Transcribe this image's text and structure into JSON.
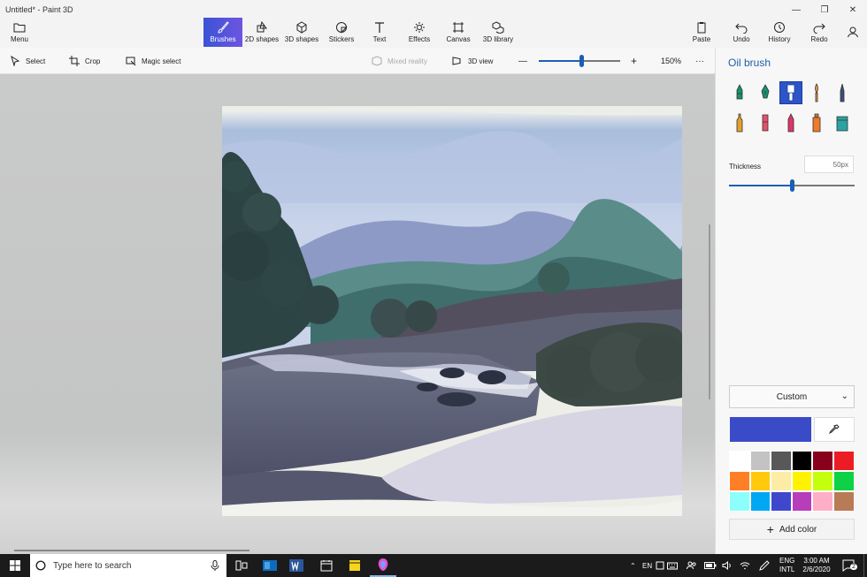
{
  "window": {
    "title": "Untitled* - Paint 3D",
    "controls": [
      "—",
      "❐",
      "✕"
    ]
  },
  "ribbon": {
    "menu_label": "Menu",
    "tabs": [
      {
        "label": "Brushes",
        "icon": "brush-icon",
        "active": true
      },
      {
        "label": "2D shapes",
        "icon": "2d-shapes-icon"
      },
      {
        "label": "3D shapes",
        "icon": "3d-shapes-icon"
      },
      {
        "label": "Stickers",
        "icon": "stickers-icon"
      },
      {
        "label": "Text",
        "icon": "text-icon"
      },
      {
        "label": "Effects",
        "icon": "effects-icon"
      },
      {
        "label": "Canvas",
        "icon": "canvas-icon"
      },
      {
        "label": "3D library",
        "icon": "3d-library-icon"
      }
    ],
    "actions": [
      {
        "label": "Paste",
        "icon": "paste-icon"
      },
      {
        "label": "Undo",
        "icon": "undo-icon"
      },
      {
        "label": "History",
        "icon": "history-icon"
      },
      {
        "label": "Redo",
        "icon": "redo-icon"
      }
    ],
    "user_icon": "user-icon"
  },
  "toolbar": {
    "select_label": "Select",
    "crop_label": "Crop",
    "magic_select_label": "Magic select",
    "mixed_reality_label": "Mixed reality",
    "view_3d_label": "3D view",
    "zoom_minus": "—",
    "zoom_plus": "+",
    "zoom_level": "150%",
    "zoom_fraction": 0.52,
    "more_label": "···"
  },
  "panel": {
    "title": "Oil brush",
    "brushes": [
      {
        "name": "marker-icon",
        "color": "#1a8f6e"
      },
      {
        "name": "calligraphy-pen-icon",
        "color": "#1a8f6e"
      },
      {
        "name": "oil-brush-icon",
        "color": "#ffffff",
        "active": true
      },
      {
        "name": "watercolor-icon",
        "color": "#e79a3b"
      },
      {
        "name": "pixel-pen-icon",
        "color": "#3c4e7a"
      },
      {
        "name": "pencil-icon",
        "color": "#e0a030"
      },
      {
        "name": "eraser-icon",
        "color": "#e84f6e"
      },
      {
        "name": "crayon-icon",
        "color": "#e0356a"
      },
      {
        "name": "spray-can-icon",
        "color": "#ef7a2b"
      },
      {
        "name": "fill-icon",
        "color": "#2aa3a3"
      }
    ],
    "thickness_label": "Thickness",
    "thickness_value": "50px",
    "thickness_fraction": 0.5,
    "color_mode": "Custom",
    "current_color": "#3a4bc8",
    "palette": [
      "#ffffff",
      "#c3c3c3",
      "#585858",
      "#000000",
      "#88001b",
      "#ec1c24",
      "#ff7f27",
      "#ffc90e",
      "#fdeca6",
      "#fff200",
      "#c4ff0e",
      "#0ed145",
      "#8cfffb",
      "#00a8f3",
      "#3f48cc",
      "#b83dba",
      "#ffaec8",
      "#b97a56"
    ],
    "add_color_label": "Add color"
  },
  "taskbar": {
    "search_placeholder": "Type here to search",
    "apps": [
      "task-view-icon",
      "outlook-icon",
      "word-icon",
      "calendar-icon",
      "sticky-notes-icon",
      "paint-3d-icon"
    ],
    "language_top": "ENG",
    "language_bottom": "INTL",
    "ime": "EN",
    "time": "3:00 AM",
    "date": "2/6/2020",
    "notifications": "2"
  }
}
